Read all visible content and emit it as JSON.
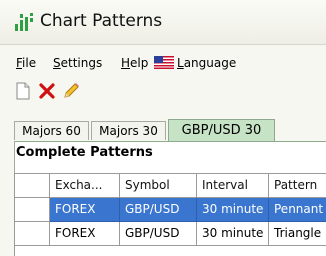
{
  "window": {
    "title": "Chart Patterns"
  },
  "menu": {
    "file": {
      "underline": "F",
      "rest": "ile"
    },
    "settings": {
      "underline": "S",
      "rest": "ettings"
    },
    "help": {
      "underline": "H",
      "rest": "elp"
    },
    "language": {
      "underline": "L",
      "rest": "anguage"
    }
  },
  "toolbar": {
    "icons": [
      "new-document-icon",
      "delete-icon",
      "edit-pencil-icon"
    ]
  },
  "tabs": [
    {
      "label": "Majors 60",
      "active": false
    },
    {
      "label": "Majors 30",
      "active": false
    },
    {
      "label": "GBP/USD 30",
      "active": true
    }
  ],
  "section": {
    "title": "Complete Patterns"
  },
  "table": {
    "columns": [
      "",
      "Excha...",
      "Symbol",
      "Interval",
      "Pattern"
    ],
    "rows": [
      {
        "selected": true,
        "cells": [
          "",
          "FOREX",
          "GBP/USD",
          "30 minute",
          "Pennant"
        ]
      },
      {
        "selected": false,
        "cells": [
          "",
          "FOREX",
          "GBP/USD",
          "30 minute",
          "Triangle"
        ]
      }
    ]
  },
  "colors": {
    "selection": "#3a76d0",
    "active_tab": "#c7e3c6"
  }
}
